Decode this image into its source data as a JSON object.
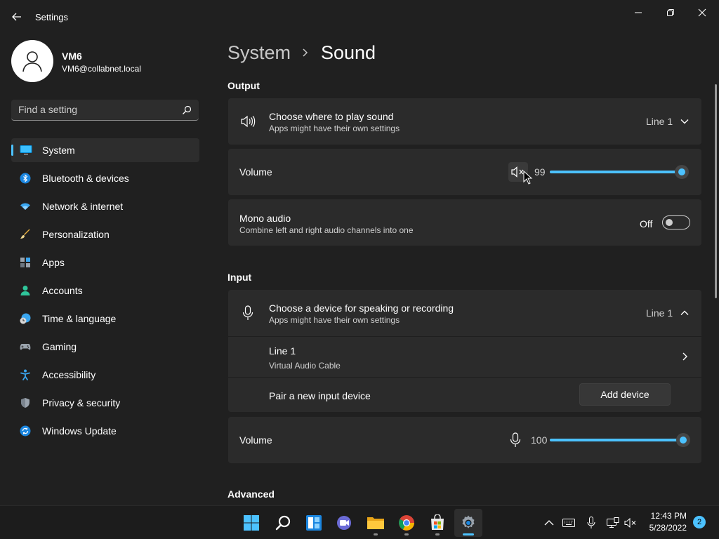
{
  "window": {
    "title": "Settings"
  },
  "profile": {
    "name": "VM6",
    "email": "VM6@collabnet.local"
  },
  "search": {
    "placeholder": "Find a setting"
  },
  "nav": {
    "items": [
      {
        "label": "System",
        "icon": "monitor-icon",
        "selected": true
      },
      {
        "label": "Bluetooth & devices",
        "icon": "bluetooth-icon"
      },
      {
        "label": "Network & internet",
        "icon": "wifi-icon"
      },
      {
        "label": "Personalization",
        "icon": "brush-icon"
      },
      {
        "label": "Apps",
        "icon": "apps-icon"
      },
      {
        "label": "Accounts",
        "icon": "person-icon"
      },
      {
        "label": "Time & language",
        "icon": "clock-globe-icon"
      },
      {
        "label": "Gaming",
        "icon": "gamepad-icon"
      },
      {
        "label": "Accessibility",
        "icon": "accessibility-icon"
      },
      {
        "label": "Privacy & security",
        "icon": "shield-icon"
      },
      {
        "label": "Windows Update",
        "icon": "update-icon"
      }
    ]
  },
  "breadcrumb": {
    "parent": "System",
    "current": "Sound"
  },
  "output": {
    "heading": "Output",
    "device": {
      "title": "Choose where to play sound",
      "subtitle": "Apps might have their own settings",
      "value": "Line 1"
    },
    "volume": {
      "label": "Volume",
      "value": "99",
      "level": 0.99
    },
    "mono": {
      "title": "Mono audio",
      "subtitle": "Combine left and right audio channels into one",
      "state": "Off"
    }
  },
  "input": {
    "heading": "Input",
    "device": {
      "title": "Choose a device for speaking or recording",
      "subtitle": "Apps might have their own settings",
      "value": "Line 1"
    },
    "line": {
      "title": "Line 1",
      "subtitle": "Virtual Audio Cable"
    },
    "pair": {
      "label": "Pair a new input device",
      "button": "Add device"
    },
    "volume": {
      "label": "Volume",
      "value": "100",
      "level": 1.0
    }
  },
  "advanced": {
    "heading": "Advanced"
  },
  "taskbar": {
    "time": "12:43 PM",
    "date": "5/28/2022",
    "notifications": "2"
  },
  "colors": {
    "accent": "#4cc2ff",
    "background": "#202020",
    "card": "#2b2b2b"
  }
}
